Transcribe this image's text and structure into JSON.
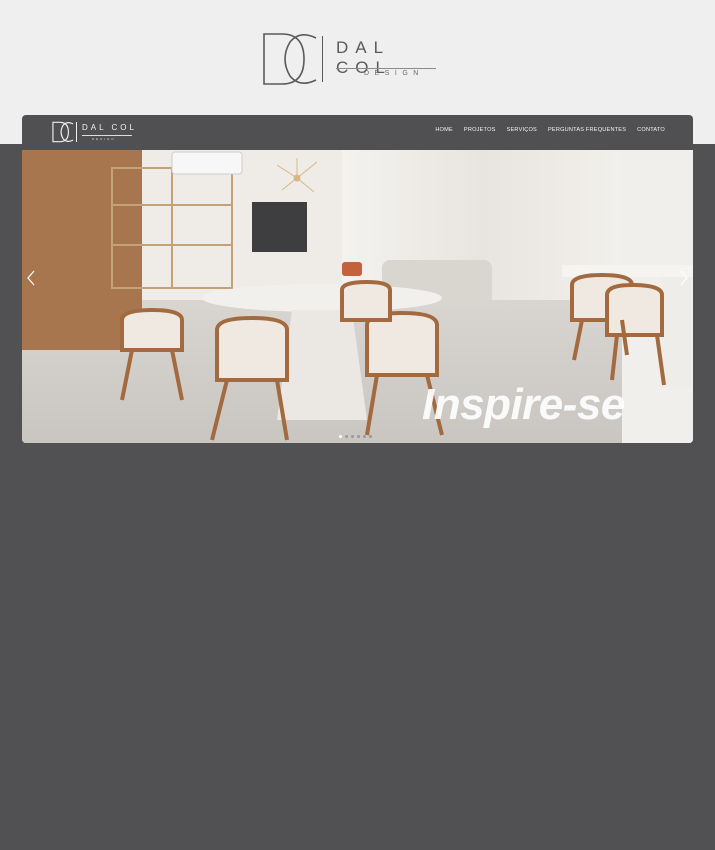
{
  "brand": {
    "name": "DAL COL",
    "tagline": "DESIGN",
    "monogram": "DC"
  },
  "nav": {
    "items": [
      {
        "label": "HOME"
      },
      {
        "label": "PROJETOS"
      },
      {
        "label": "SERVIÇOS"
      },
      {
        "label": "PERGUNTAS FREQUENTES"
      },
      {
        "label": "CONTATO"
      }
    ]
  },
  "slider": {
    "caption": "Inspire-se",
    "slide_count": 6,
    "active_slide": 1,
    "prev_icon": "chevron-left-icon",
    "next_icon": "chevron-right-icon"
  },
  "colors": {
    "page_bg": "#515053",
    "header_bg": "#efefef",
    "nav_bg": "#505053"
  }
}
